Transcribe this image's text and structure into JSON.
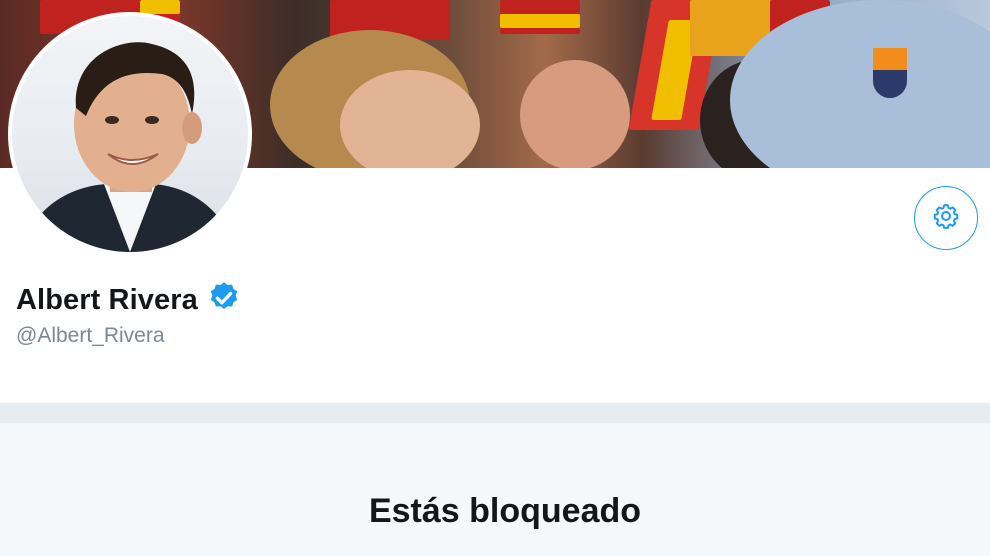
{
  "profile": {
    "display_name": "Albert Rivera",
    "handle": "@Albert_Rivera",
    "verified": true
  },
  "icons": {
    "verified": "verified-badge-icon",
    "settings": "gear-icon"
  },
  "blocked": {
    "title": "Estás bloqueado"
  },
  "colors": {
    "accent": "#1d9bf0",
    "name_text": "#14171a",
    "handle_text": "#7a8893",
    "band": "#e6ecf0",
    "panel_bg": "#f5f8fa"
  }
}
